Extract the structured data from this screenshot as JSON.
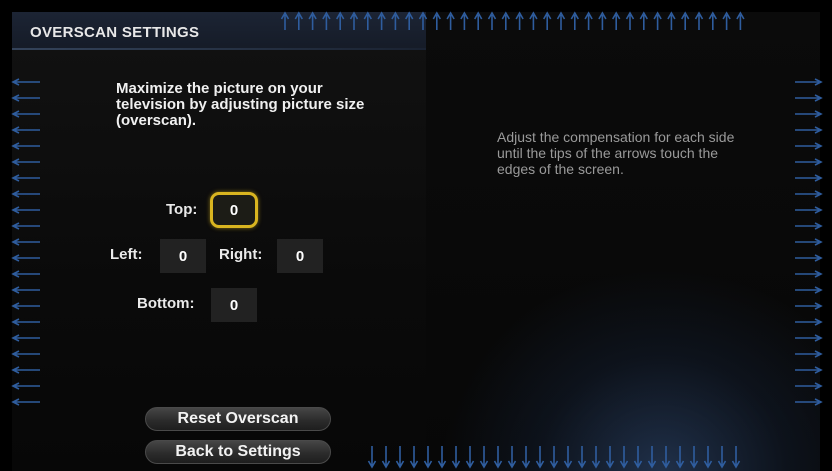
{
  "title": "OVERSCAN SETTINGS",
  "instructions": "Maximize the picture on your television by adjusting picture size (overscan).",
  "hint": "Adjust the compensation for each side until the tips of the arrows touch the edges of the screen.",
  "overscan": {
    "top": {
      "label": "Top:",
      "value": "0"
    },
    "left": {
      "label": "Left:",
      "value": "0"
    },
    "right": {
      "label": "Right:",
      "value": "0"
    },
    "bottom": {
      "label": "Bottom:",
      "value": "0"
    }
  },
  "buttons": {
    "reset": "Reset Overscan",
    "back": "Back to Settings"
  },
  "focused_field": "top",
  "colors": {
    "focus_ring": "#d9b520",
    "arrow": "#2f5d9e",
    "title_bar": "#1c2434"
  },
  "edge_arrows": {
    "icon": "calibration-arrow-icon"
  }
}
